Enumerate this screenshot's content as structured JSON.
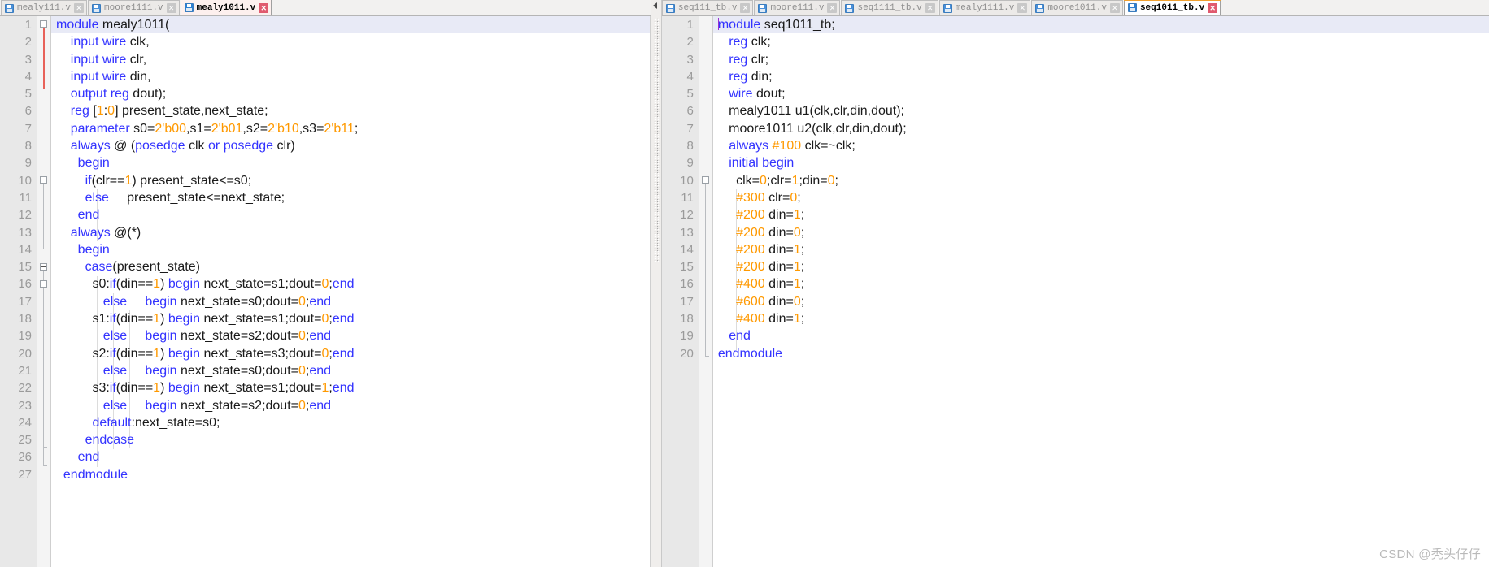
{
  "app": {
    "watermark": "CSDN @秃头仔仔"
  },
  "left_pane": {
    "name": "mealy1011-editor",
    "tabs": [
      {
        "label": "mealy111.v",
        "icon": "file-verilog-icon",
        "close": "✕",
        "active": false
      },
      {
        "label": "moore1111.v",
        "icon": "file-verilog-icon",
        "close": "✕",
        "active": false
      },
      {
        "label": "mealy1011.v",
        "icon": "file-verilog-icon",
        "close": "✕",
        "active": true
      }
    ],
    "active_tab": "mealy1011.v",
    "current_line": 1,
    "line_numbers": [
      1,
      2,
      3,
      4,
      5,
      6,
      7,
      8,
      9,
      10,
      11,
      12,
      13,
      14,
      15,
      16,
      17,
      18,
      19,
      20,
      21,
      22,
      23,
      24,
      25,
      26,
      27
    ],
    "code": [
      [
        {
          "t": "module",
          "c": "k"
        },
        {
          "t": " mealy1011(",
          "c": "id"
        }
      ],
      [
        {
          "t": "    ",
          "c": "id"
        },
        {
          "t": "input wire",
          "c": "k"
        },
        {
          "t": " clk,",
          "c": "id"
        }
      ],
      [
        {
          "t": "    ",
          "c": "id"
        },
        {
          "t": "input wire",
          "c": "k"
        },
        {
          "t": " clr,",
          "c": "id"
        }
      ],
      [
        {
          "t": "    ",
          "c": "id"
        },
        {
          "t": "input wire",
          "c": "k"
        },
        {
          "t": " din,",
          "c": "id"
        }
      ],
      [
        {
          "t": "    ",
          "c": "id"
        },
        {
          "t": "output reg",
          "c": "k"
        },
        {
          "t": " dout);",
          "c": "id"
        }
      ],
      [
        {
          "t": "    ",
          "c": "id"
        },
        {
          "t": "reg",
          "c": "k"
        },
        {
          "t": " [",
          "c": "id"
        },
        {
          "t": "1",
          "c": "n"
        },
        {
          "t": ":",
          "c": "id"
        },
        {
          "t": "0",
          "c": "n"
        },
        {
          "t": "] present_state,next_state;",
          "c": "id"
        }
      ],
      [
        {
          "t": "    ",
          "c": "id"
        },
        {
          "t": "parameter",
          "c": "k"
        },
        {
          "t": " s0=",
          "c": "id"
        },
        {
          "t": "2'b00",
          "c": "n"
        },
        {
          "t": ",s1=",
          "c": "id"
        },
        {
          "t": "2'b01",
          "c": "n"
        },
        {
          "t": ",s2=",
          "c": "id"
        },
        {
          "t": "2'b10",
          "c": "n"
        },
        {
          "t": ",s3=",
          "c": "id"
        },
        {
          "t": "2'b11",
          "c": "n"
        },
        {
          "t": ";",
          "c": "id"
        }
      ],
      [
        {
          "t": "    ",
          "c": "id"
        },
        {
          "t": "always",
          "c": "k"
        },
        {
          "t": " @ (",
          "c": "id"
        },
        {
          "t": "posedge",
          "c": "k"
        },
        {
          "t": " clk ",
          "c": "id"
        },
        {
          "t": "or",
          "c": "k"
        },
        {
          "t": " ",
          "c": "id"
        },
        {
          "t": "posedge",
          "c": "k"
        },
        {
          "t": " clr)",
          "c": "id"
        }
      ],
      [
        {
          "t": "      ",
          "c": "id"
        },
        {
          "t": "begin",
          "c": "k"
        }
      ],
      [
        {
          "t": "        ",
          "c": "id"
        },
        {
          "t": "if",
          "c": "k"
        },
        {
          "t": "(clr==",
          "c": "id"
        },
        {
          "t": "1",
          "c": "n"
        },
        {
          "t": ") present_state<=s0;",
          "c": "id"
        }
      ],
      [
        {
          "t": "        ",
          "c": "id"
        },
        {
          "t": "else",
          "c": "k"
        },
        {
          "t": "     present_state<=next_state;",
          "c": "id"
        }
      ],
      [
        {
          "t": "      ",
          "c": "id"
        },
        {
          "t": "end",
          "c": "k"
        }
      ],
      [
        {
          "t": "    ",
          "c": "id"
        },
        {
          "t": "always",
          "c": "k"
        },
        {
          "t": " @(*)",
          "c": "id"
        }
      ],
      [
        {
          "t": "      ",
          "c": "id"
        },
        {
          "t": "begin",
          "c": "k"
        }
      ],
      [
        {
          "t": "        ",
          "c": "id"
        },
        {
          "t": "case",
          "c": "k"
        },
        {
          "t": "(present_state)",
          "c": "id"
        }
      ],
      [
        {
          "t": "          s0:",
          "c": "id"
        },
        {
          "t": "if",
          "c": "k"
        },
        {
          "t": "(din==",
          "c": "id"
        },
        {
          "t": "1",
          "c": "n"
        },
        {
          "t": ") ",
          "c": "id"
        },
        {
          "t": "begin",
          "c": "k"
        },
        {
          "t": " next_state=s1;dout=",
          "c": "id"
        },
        {
          "t": "0",
          "c": "n"
        },
        {
          "t": ";",
          "c": "id"
        },
        {
          "t": "end",
          "c": "k"
        }
      ],
      [
        {
          "t": "             ",
          "c": "id"
        },
        {
          "t": "else",
          "c": "k"
        },
        {
          "t": "     ",
          "c": "id"
        },
        {
          "t": "begin",
          "c": "k"
        },
        {
          "t": " next_state=s0;dout=",
          "c": "id"
        },
        {
          "t": "0",
          "c": "n"
        },
        {
          "t": ";",
          "c": "id"
        },
        {
          "t": "end",
          "c": "k"
        }
      ],
      [
        {
          "t": "          s1:",
          "c": "id"
        },
        {
          "t": "if",
          "c": "k"
        },
        {
          "t": "(din==",
          "c": "id"
        },
        {
          "t": "1",
          "c": "n"
        },
        {
          "t": ") ",
          "c": "id"
        },
        {
          "t": "begin",
          "c": "k"
        },
        {
          "t": " next_state=s1;dout=",
          "c": "id"
        },
        {
          "t": "0",
          "c": "n"
        },
        {
          "t": ";",
          "c": "id"
        },
        {
          "t": "end",
          "c": "k"
        }
      ],
      [
        {
          "t": "             ",
          "c": "id"
        },
        {
          "t": "else",
          "c": "k"
        },
        {
          "t": "     ",
          "c": "id"
        },
        {
          "t": "begin",
          "c": "k"
        },
        {
          "t": " next_state=s2;dout=",
          "c": "id"
        },
        {
          "t": "0",
          "c": "n"
        },
        {
          "t": ";",
          "c": "id"
        },
        {
          "t": "end",
          "c": "k"
        }
      ],
      [
        {
          "t": "          s2:",
          "c": "id"
        },
        {
          "t": "if",
          "c": "k"
        },
        {
          "t": "(din==",
          "c": "id"
        },
        {
          "t": "1",
          "c": "n"
        },
        {
          "t": ") ",
          "c": "id"
        },
        {
          "t": "begin",
          "c": "k"
        },
        {
          "t": " next_state=s3;dout=",
          "c": "id"
        },
        {
          "t": "0",
          "c": "n"
        },
        {
          "t": ";",
          "c": "id"
        },
        {
          "t": "end",
          "c": "k"
        }
      ],
      [
        {
          "t": "             ",
          "c": "id"
        },
        {
          "t": "else",
          "c": "k"
        },
        {
          "t": "     ",
          "c": "id"
        },
        {
          "t": "begin",
          "c": "k"
        },
        {
          "t": " next_state=s0;dout=",
          "c": "id"
        },
        {
          "t": "0",
          "c": "n"
        },
        {
          "t": ";",
          "c": "id"
        },
        {
          "t": "end",
          "c": "k"
        }
      ],
      [
        {
          "t": "          s3:",
          "c": "id"
        },
        {
          "t": "if",
          "c": "k"
        },
        {
          "t": "(din==",
          "c": "id"
        },
        {
          "t": "1",
          "c": "n"
        },
        {
          "t": ") ",
          "c": "id"
        },
        {
          "t": "begin",
          "c": "k"
        },
        {
          "t": " next_state=s1;dout=",
          "c": "id"
        },
        {
          "t": "1",
          "c": "n"
        },
        {
          "t": ";",
          "c": "id"
        },
        {
          "t": "end",
          "c": "k"
        }
      ],
      [
        {
          "t": "             ",
          "c": "id"
        },
        {
          "t": "else",
          "c": "k"
        },
        {
          "t": "     ",
          "c": "id"
        },
        {
          "t": "begin",
          "c": "k"
        },
        {
          "t": " next_state=s2;dout=",
          "c": "id"
        },
        {
          "t": "0",
          "c": "n"
        },
        {
          "t": ";",
          "c": "id"
        },
        {
          "t": "end",
          "c": "k"
        }
      ],
      [
        {
          "t": "          ",
          "c": "id"
        },
        {
          "t": "default",
          "c": "k"
        },
        {
          "t": ":next_state=s0;",
          "c": "id"
        }
      ],
      [
        {
          "t": "        ",
          "c": "id"
        },
        {
          "t": "endcase",
          "c": "k"
        }
      ],
      [
        {
          "t": "      ",
          "c": "id"
        },
        {
          "t": "end",
          "c": "k"
        }
      ],
      [
        {
          "t": "  ",
          "c": "id"
        },
        {
          "t": "endmodule",
          "c": "k"
        }
      ]
    ]
  },
  "right_pane": {
    "name": "seq1011-tb-editor",
    "tabs": [
      {
        "label": "seq111_tb.v",
        "icon": "file-verilog-icon",
        "close": "✕",
        "active": false
      },
      {
        "label": "moore111.v",
        "icon": "file-verilog-icon",
        "close": "✕",
        "active": false
      },
      {
        "label": "seq1111_tb.v",
        "icon": "file-verilog-icon",
        "close": "✕",
        "active": false
      },
      {
        "label": "mealy1111.v",
        "icon": "file-verilog-icon",
        "close": "✕",
        "active": false
      },
      {
        "label": "moore1011.v",
        "icon": "file-verilog-icon",
        "close": "✕",
        "active": false
      },
      {
        "label": "seq1011_tb.v",
        "icon": "file-verilog-icon",
        "close": "✕",
        "active": true
      }
    ],
    "active_tab": "seq1011_tb.v",
    "current_line": 1,
    "line_numbers": [
      1,
      2,
      3,
      4,
      5,
      6,
      7,
      8,
      9,
      10,
      11,
      12,
      13,
      14,
      15,
      16,
      17,
      18,
      19,
      20
    ],
    "code": [
      [
        {
          "t": "module",
          "c": "k"
        },
        {
          "t": " seq1011_tb;",
          "c": "id"
        }
      ],
      [
        {
          "t": "   ",
          "c": "id"
        },
        {
          "t": "reg",
          "c": "k"
        },
        {
          "t": " clk;",
          "c": "id"
        }
      ],
      [
        {
          "t": "   ",
          "c": "id"
        },
        {
          "t": "reg",
          "c": "k"
        },
        {
          "t": " clr;",
          "c": "id"
        }
      ],
      [
        {
          "t": "   ",
          "c": "id"
        },
        {
          "t": "reg",
          "c": "k"
        },
        {
          "t": " din;",
          "c": "id"
        }
      ],
      [
        {
          "t": "   ",
          "c": "id"
        },
        {
          "t": "wire",
          "c": "k"
        },
        {
          "t": " dout;",
          "c": "id"
        }
      ],
      [
        {
          "t": "   mealy1011 u1(clk,clr,din,dout);",
          "c": "id"
        }
      ],
      [
        {
          "t": "   moore1011 u2(clk,clr,din,dout);",
          "c": "id"
        }
      ],
      [
        {
          "t": "   ",
          "c": "id"
        },
        {
          "t": "always",
          "c": "k"
        },
        {
          "t": " ",
          "c": "id"
        },
        {
          "t": "#100",
          "c": "n"
        },
        {
          "t": " clk=~clk;",
          "c": "id"
        }
      ],
      [
        {
          "t": "   ",
          "c": "id"
        },
        {
          "t": "initial begin",
          "c": "k"
        }
      ],
      [
        {
          "t": "     clk=",
          "c": "id"
        },
        {
          "t": "0",
          "c": "n"
        },
        {
          "t": ";clr=",
          "c": "id"
        },
        {
          "t": "1",
          "c": "n"
        },
        {
          "t": ";din=",
          "c": "id"
        },
        {
          "t": "0",
          "c": "n"
        },
        {
          "t": ";",
          "c": "id"
        }
      ],
      [
        {
          "t": "     ",
          "c": "id"
        },
        {
          "t": "#300",
          "c": "n"
        },
        {
          "t": " clr=",
          "c": "id"
        },
        {
          "t": "0",
          "c": "n"
        },
        {
          "t": ";",
          "c": "id"
        }
      ],
      [
        {
          "t": "     ",
          "c": "id"
        },
        {
          "t": "#200",
          "c": "n"
        },
        {
          "t": " din=",
          "c": "id"
        },
        {
          "t": "1",
          "c": "n"
        },
        {
          "t": ";",
          "c": "id"
        }
      ],
      [
        {
          "t": "     ",
          "c": "id"
        },
        {
          "t": "#200",
          "c": "n"
        },
        {
          "t": " din=",
          "c": "id"
        },
        {
          "t": "0",
          "c": "n"
        },
        {
          "t": ";",
          "c": "id"
        }
      ],
      [
        {
          "t": "     ",
          "c": "id"
        },
        {
          "t": "#200",
          "c": "n"
        },
        {
          "t": " din=",
          "c": "id"
        },
        {
          "t": "1",
          "c": "n"
        },
        {
          "t": ";",
          "c": "id"
        }
      ],
      [
        {
          "t": "     ",
          "c": "id"
        },
        {
          "t": "#200",
          "c": "n"
        },
        {
          "t": " din=",
          "c": "id"
        },
        {
          "t": "1",
          "c": "n"
        },
        {
          "t": ";",
          "c": "id"
        }
      ],
      [
        {
          "t": "     ",
          "c": "id"
        },
        {
          "t": "#400",
          "c": "n"
        },
        {
          "t": " din=",
          "c": "id"
        },
        {
          "t": "1",
          "c": "n"
        },
        {
          "t": ";",
          "c": "id"
        }
      ],
      [
        {
          "t": "     ",
          "c": "id"
        },
        {
          "t": "#600",
          "c": "n"
        },
        {
          "t": " din=",
          "c": "id"
        },
        {
          "t": "0",
          "c": "n"
        },
        {
          "t": ";",
          "c": "id"
        }
      ],
      [
        {
          "t": "     ",
          "c": "id"
        },
        {
          "t": "#400",
          "c": "n"
        },
        {
          "t": " din=",
          "c": "id"
        },
        {
          "t": "1",
          "c": "n"
        },
        {
          "t": ";",
          "c": "id"
        }
      ],
      [
        {
          "t": "   ",
          "c": "id"
        },
        {
          "t": "end",
          "c": "k"
        }
      ],
      [
        {
          "t": "",
          "c": "id"
        },
        {
          "t": "endmodule",
          "c": "k"
        }
      ]
    ]
  },
  "colors": {
    "keyword": "#3333ff",
    "number": "#ff9900",
    "identifier": "#1a1a1a",
    "current_line_bg": "#e8eaf6",
    "gutter_bg": "#e8e8e8",
    "tab_active_accent": "#f0a030"
  }
}
